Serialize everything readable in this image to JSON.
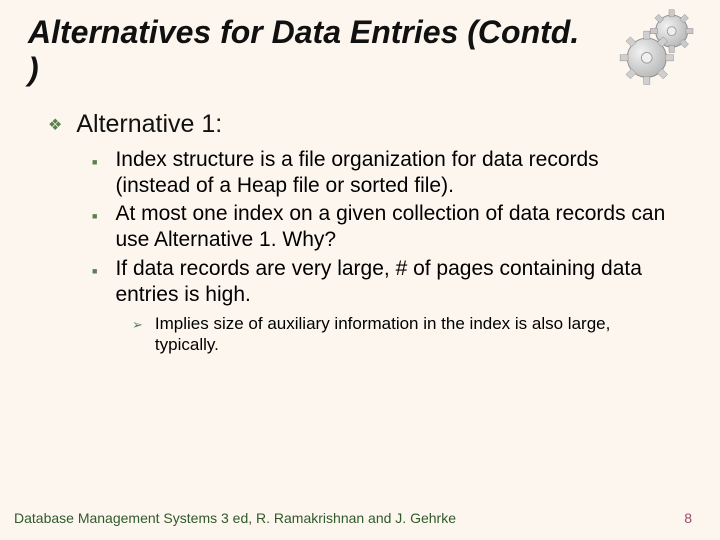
{
  "title": "Alternatives for Data Entries (Contd. )",
  "heading": "Alternative 1:",
  "bullets": [
    "Index structure is a file organization for data records (instead of a Heap file or sorted file).",
    "At most one index on a given collection of data records can use Alternative 1. Why?",
    "If data records are very large,  # of pages containing data entries is high."
  ],
  "sub_bullet": "Implies size of auxiliary information in the index is also large, typically.",
  "footer": {
    "left": "Database Management Systems 3 ed, R. Ramakrishnan and J. Gehrke",
    "page": "8"
  },
  "icons": {
    "gears": "gears-icon"
  }
}
